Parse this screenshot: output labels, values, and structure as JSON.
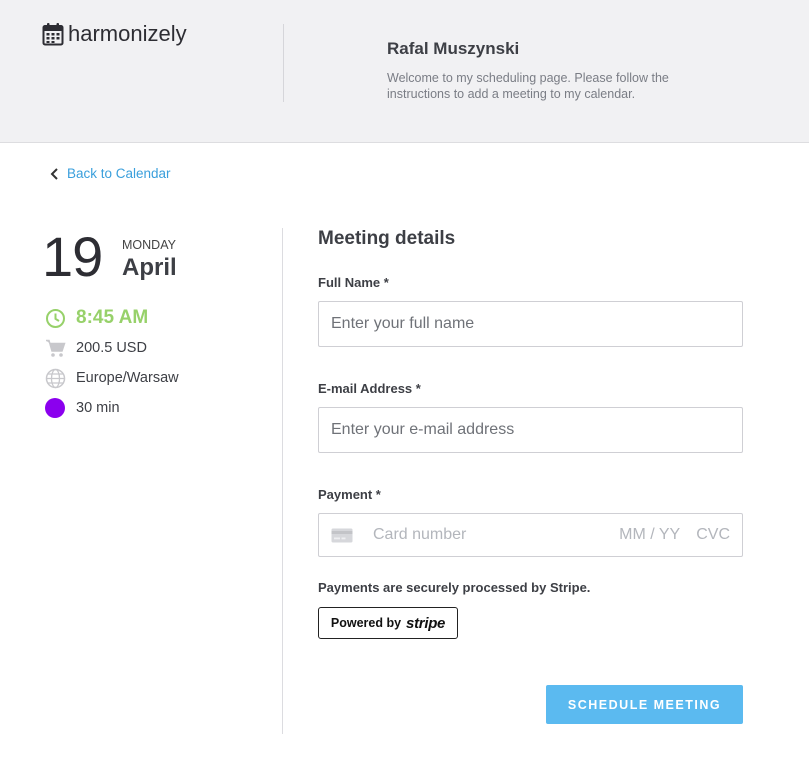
{
  "header": {
    "logo_text": "harmonizely",
    "owner_name": "Rafal Muszynski",
    "welcome_text": "Welcome to my scheduling page. Please follow the instructions to add a meeting to my calendar."
  },
  "nav": {
    "back_label": "Back to Calendar"
  },
  "event": {
    "day": "19",
    "weekday": "MONDAY",
    "month": "April",
    "time": "8:45 AM",
    "price": "200.5 USD",
    "timezone": "Europe/Warsaw",
    "duration": "30 min",
    "time_color": "#97d16a",
    "duration_color": "#8b00ee"
  },
  "form": {
    "title": "Meeting details",
    "full_name": {
      "label": "Full Name *",
      "placeholder": "Enter your full name",
      "value": ""
    },
    "email": {
      "label": "E-mail Address *",
      "placeholder": "Enter your e-mail address",
      "value": ""
    },
    "payment": {
      "label": "Payment *",
      "card_placeholder": "Card number",
      "expiry_placeholder": "MM / YY",
      "cvc_placeholder": "CVC"
    },
    "secure_note": "Payments are securely processed by Stripe.",
    "stripe_badge": {
      "prefix": "Powered by",
      "brand": "stripe"
    },
    "submit_label": "SCHEDULE MEETING",
    "accent_color": "#5bbaf0"
  }
}
